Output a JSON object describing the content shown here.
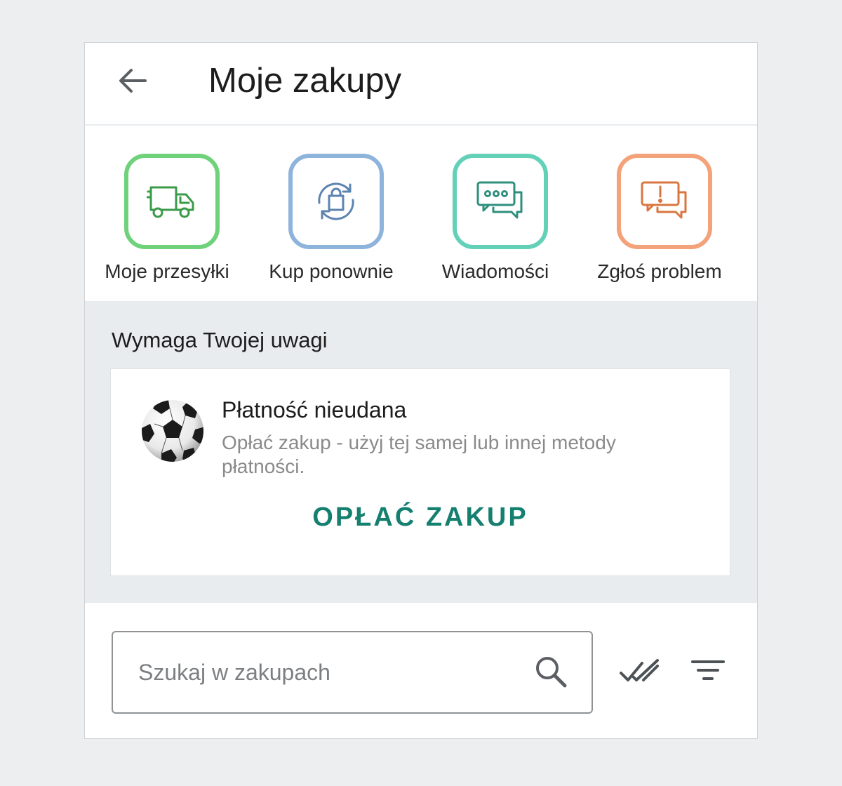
{
  "header": {
    "title": "Moje zakupy",
    "back_icon": "arrow-left-icon"
  },
  "actions": [
    {
      "label": "Moje przesyłki",
      "icon": "truck-icon",
      "color": "#6fd27a"
    },
    {
      "label": "Kup ponownie",
      "icon": "shopping-bag-refresh-icon",
      "color": "#8fb4dc"
    },
    {
      "label": "Wiadomości",
      "icon": "chat-bubbles-icon",
      "color": "#63d0b8"
    },
    {
      "label": "Zgłoś problem",
      "icon": "report-problem-icon",
      "color": "#f3a27a"
    }
  ],
  "attention": {
    "title": "Wymaga Twojej uwagi",
    "card": {
      "title": "Płatność nieudana",
      "description": "Opłać zakup - użyj tej samej lub innej metody płatności.",
      "action_label": "OPŁAĆ ZAKUP",
      "image": "soccer-ball-icon",
      "action_color": "#168070"
    }
  },
  "search": {
    "placeholder": "Szukaj w zakupach",
    "value": "",
    "search_icon": "search-icon",
    "mark_all_icon": "double-check-icon",
    "filter_icon": "filter-icon"
  }
}
